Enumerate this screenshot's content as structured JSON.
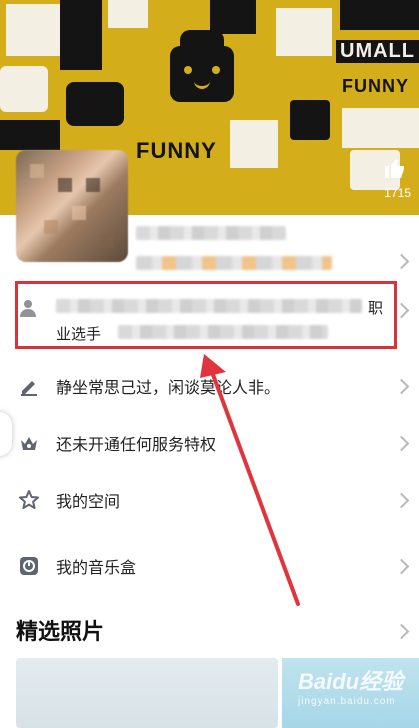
{
  "banner": {
    "words": [
      "UMALL",
      "FUNNY",
      "FUNNY"
    ],
    "like_count": "1715"
  },
  "bio_row": {
    "label_end": "职",
    "label_line2": "业选手"
  },
  "menu": [
    {
      "label": "静坐常思己过，闲谈莫论人非。",
      "icon": "pen-icon"
    },
    {
      "label": "还未开通任何服务特权",
      "icon": "crown-icon"
    },
    {
      "label": "我的空间",
      "icon": "star-icon"
    },
    {
      "label": "我的音乐盒",
      "icon": "music-box-icon"
    }
  ],
  "section": {
    "title": "精选照片"
  },
  "watermark": {
    "brand": "Baidu经验",
    "sub": "jingyan.baidu.com"
  },
  "colors": {
    "banner": "#d3ae1a",
    "highlight": "#d8323b",
    "arrow": "#e0353d"
  }
}
